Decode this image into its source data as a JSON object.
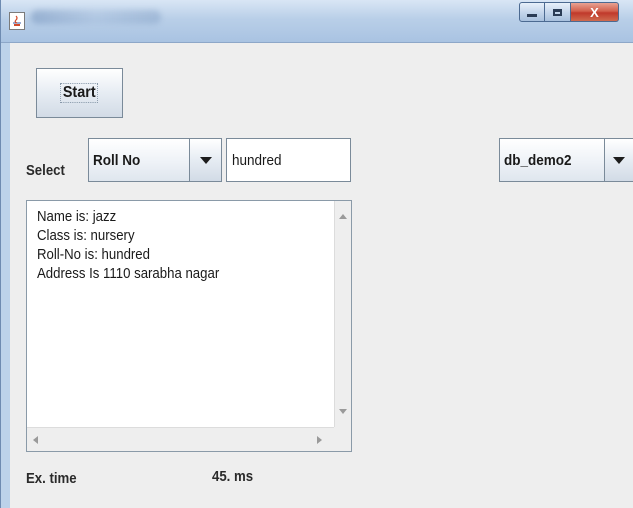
{
  "window": {
    "close_glyph": "X",
    "app_icon": "java-cup-icon"
  },
  "toolbar": {
    "start_label": "Start"
  },
  "query": {
    "select_label": "Select",
    "field_selected": "Roll No",
    "value": "hundred",
    "database_selected": "db_demo2"
  },
  "result": {
    "lines": [
      "Name is: jazz",
      "Class is: nursery",
      "Roll-No is: hundred",
      "Address Is 1110 sarabha nagar"
    ]
  },
  "status": {
    "time_label": "Ex. time",
    "time_value": "45. ms"
  }
}
